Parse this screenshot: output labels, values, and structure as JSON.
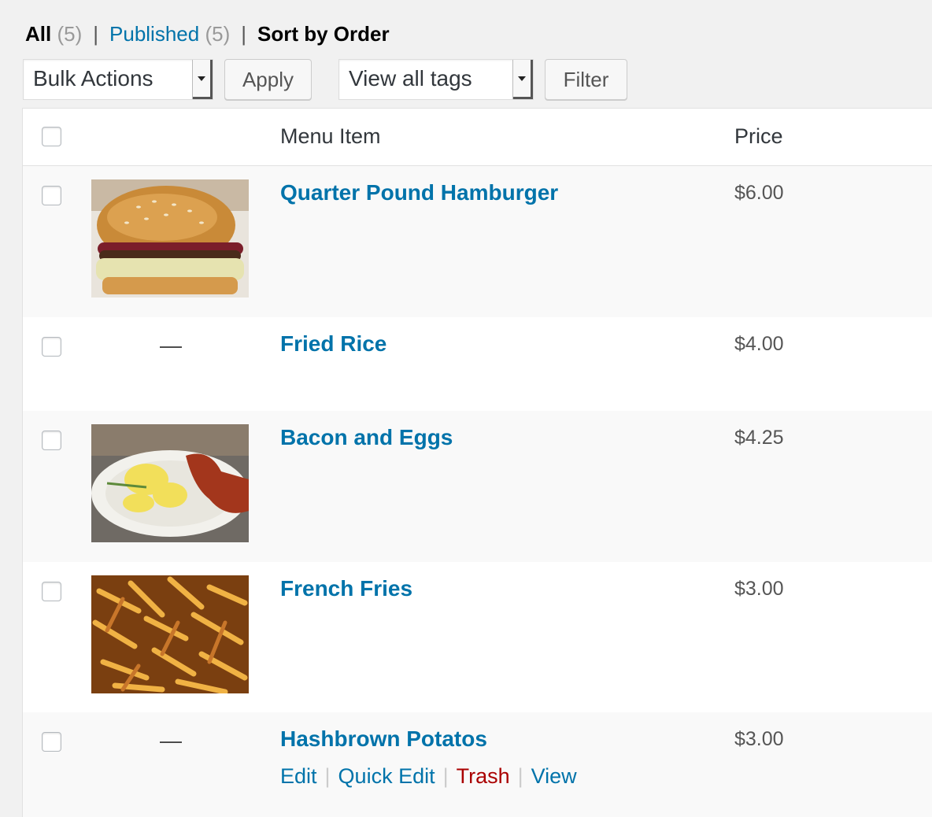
{
  "views": {
    "all_label": "All",
    "all_count": "(5)",
    "published_label": "Published",
    "published_count": "(5)",
    "sort_label": "Sort by Order",
    "separator": "|"
  },
  "toolbar": {
    "bulk_actions": "Bulk Actions",
    "apply": "Apply",
    "tags_filter": "View all tags",
    "filter": "Filter"
  },
  "table": {
    "columns": {
      "menu_item": "Menu Item",
      "price": "Price"
    },
    "rows": [
      {
        "title": "Quarter Pound Hamburger",
        "price": "$6.00",
        "thumbnail": "hamburger"
      },
      {
        "title": "Fried Rice",
        "price": "$4.00",
        "thumbnail": "—"
      },
      {
        "title": "Bacon and Eggs",
        "price": "$4.25",
        "thumbnail": "bacon-and-eggs"
      },
      {
        "title": "French Fries",
        "price": "$3.00",
        "thumbnail": "french-fries"
      },
      {
        "title": "Hashbrown Potatos",
        "price": "$3.00",
        "thumbnail": "—"
      }
    ],
    "row_actions": {
      "edit": "Edit",
      "quick_edit": "Quick Edit",
      "trash": "Trash",
      "view": "View",
      "separator": "|"
    }
  },
  "colors": {
    "link": "#0073aa",
    "trash": "#aa0000",
    "background": "#f1f1f1"
  }
}
